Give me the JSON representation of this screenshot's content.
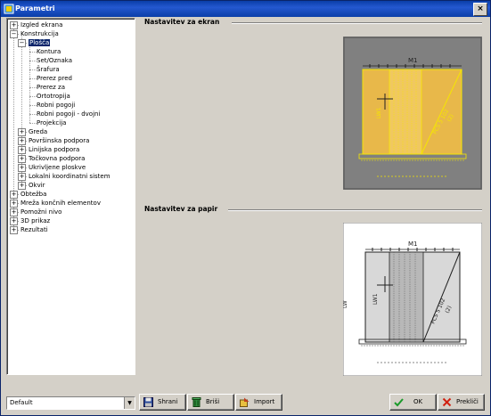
{
  "window": {
    "title": "Parametri",
    "close_glyph": "×"
  },
  "tree": {
    "items": [
      {
        "label": "Izgled ekrana",
        "exp": "+",
        "selected": false
      },
      {
        "label": "Konstrukcija",
        "exp": "−",
        "selected": false
      },
      {
        "label": "Plošča",
        "exp": "−",
        "selected": true
      },
      {
        "label": "Kontura",
        "exp": "",
        "selected": false
      },
      {
        "label": "Set/Oznaka",
        "exp": "",
        "selected": false
      },
      {
        "label": "Šrafura",
        "exp": "",
        "selected": false
      },
      {
        "label": "Prerez pred",
        "exp": "",
        "selected": false
      },
      {
        "label": "Prerez za",
        "exp": "",
        "selected": false
      },
      {
        "label": "Ortotropija",
        "exp": "",
        "selected": false
      },
      {
        "label": "Robni pogoji",
        "exp": "",
        "selected": false
      },
      {
        "label": "Robni pogoji - dvojni",
        "exp": "",
        "selected": false
      },
      {
        "label": "Projekcija",
        "exp": "",
        "selected": false
      },
      {
        "label": "Greda",
        "exp": "+",
        "selected": false
      },
      {
        "label": "Površinska podpora",
        "exp": "+",
        "selected": false
      },
      {
        "label": "Linijska podpora",
        "exp": "+",
        "selected": false
      },
      {
        "label": "Točkovna podpora",
        "exp": "+",
        "selected": false
      },
      {
        "label": "Ukrivljene ploskve",
        "exp": "+",
        "selected": false
      },
      {
        "label": "Lokalni koordinatni sistem",
        "exp": "+",
        "selected": false
      },
      {
        "label": "Okvir",
        "exp": "+",
        "selected": false
      },
      {
        "label": "Obtežba",
        "exp": "+",
        "selected": false
      },
      {
        "label": "Mreža končnih elementov",
        "exp": "+",
        "selected": false
      },
      {
        "label": "Pomožni nivo",
        "exp": "+",
        "selected": false
      },
      {
        "label": "3D prikaz",
        "exp": "+",
        "selected": false
      },
      {
        "label": "Rezultati",
        "exp": "+",
        "selected": false
      }
    ]
  },
  "screen_section": {
    "title": "Nastavitev za ekran"
  },
  "paper_section": {
    "title": "Nastavitev za papir"
  },
  "preview_labels": {
    "m1": "M1",
    "lw": "LW",
    "lw1": "LW1",
    "pcs": "PCS 5 102",
    "z": "(2)"
  },
  "preset": {
    "value": "Default",
    "arrow": "▼"
  },
  "buttons": {
    "save": "Shrani",
    "delete": "Briši",
    "import": "Import",
    "ok": "OK",
    "cancel": "Prekliči"
  },
  "colors": {
    "screen_bg": "#808080",
    "slab_fill": "#e8b84a",
    "slab_line": "#f5e600",
    "paper_line": "#202020",
    "paper_fill": "#c0c0c0"
  }
}
